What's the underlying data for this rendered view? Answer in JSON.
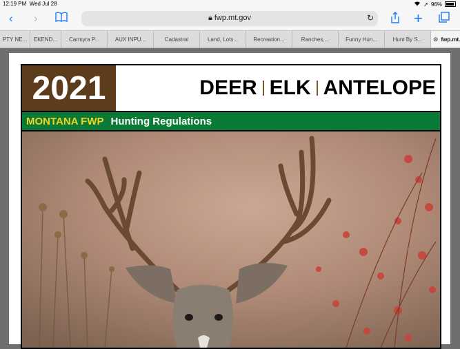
{
  "status_bar": {
    "time": "12:19 PM",
    "date": "Wed Jul 28",
    "battery": "96%"
  },
  "toolbar": {
    "url": "fwp.mt.gov"
  },
  "tabs": [
    {
      "label": "PTY NE...",
      "w": 43
    },
    {
      "label": "EKEND...",
      "w": 44
    },
    {
      "label": "Carmyra P...",
      "w": 66
    },
    {
      "label": "AUX INPU...",
      "w": 66
    },
    {
      "label": "Cadastral",
      "w": 66
    },
    {
      "label": "Land, Lots...",
      "w": 66
    },
    {
      "label": "Recreation...",
      "w": 66
    },
    {
      "label": "Ranches,...",
      "w": 66
    },
    {
      "label": "Funny Hun...",
      "w": 66
    },
    {
      "label": "Hunt By S...",
      "w": 66
    },
    {
      "label": "fwp.mt....",
      "w": 52,
      "active": true
    }
  ],
  "cover": {
    "year": "2021",
    "species": [
      "DEER",
      "ELK",
      "ANTELOPE"
    ],
    "agency": "MONTANA FWP",
    "subtitle": "Hunting Regulations"
  },
  "colors": {
    "brown": "#5c3c1a",
    "green": "#0a7a37",
    "yellow": "#f3d21f",
    "accent_blue": "#1a7cf5"
  }
}
